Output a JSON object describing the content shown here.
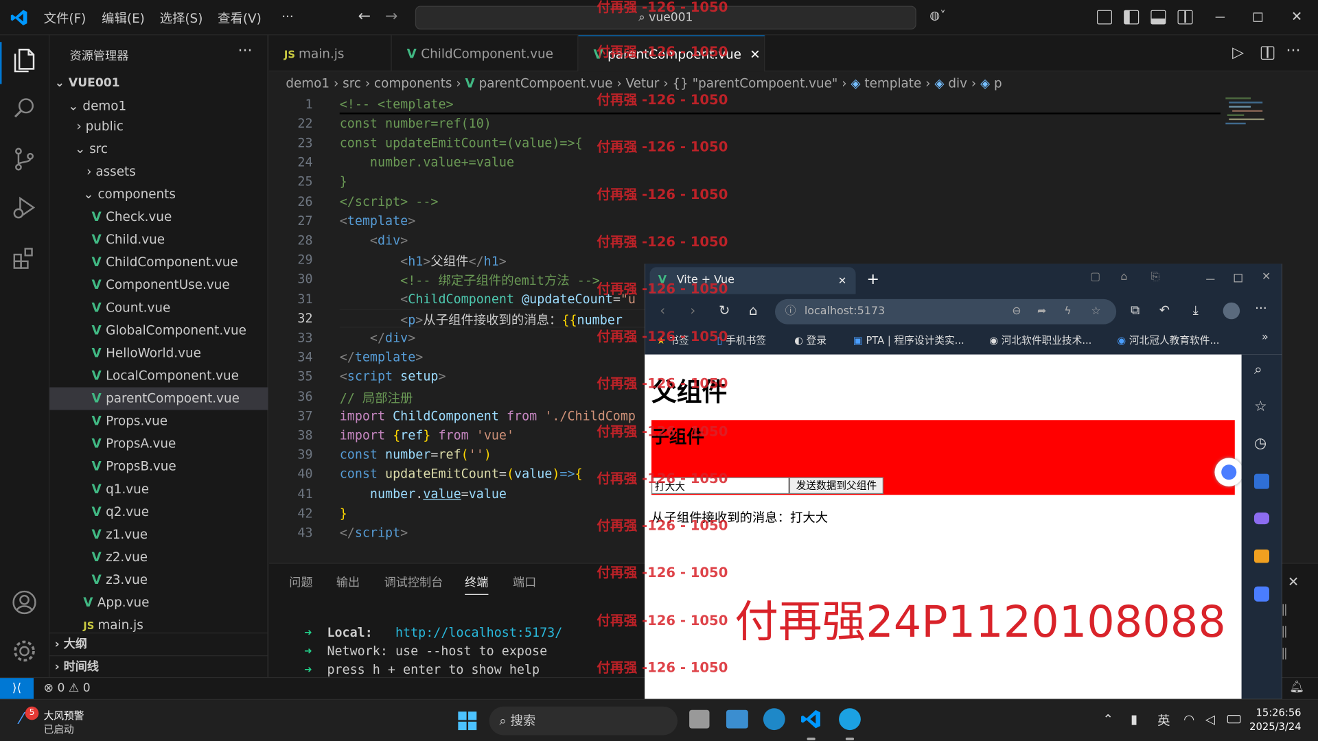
{
  "titlebar": {
    "menus": [
      "文件(F)",
      "编辑(E)",
      "选择(S)",
      "查看(V)",
      "···"
    ],
    "search": "vue001"
  },
  "sidebar": {
    "title": "资源管理器",
    "root": "VUE001",
    "items": [
      "demo1",
      "public",
      "src",
      "assets",
      "components",
      "Check.vue",
      "Child.vue",
      "ChildComponent.vue",
      "ComponentUse.vue",
      "Count.vue",
      "GlobalComponent.vue",
      "HelloWorld.vue",
      "LocalComponent.vue",
      "parentCompoent.vue",
      "Props.vue",
      "PropsA.vue",
      "PropsB.vue",
      "q1.vue",
      "q2.vue",
      "z1.vue",
      "z2.vue",
      "z3.vue",
      "App.vue",
      "main.js"
    ],
    "outline": "大纲",
    "timeline": "时间线"
  },
  "tabs": [
    "main.js",
    "ChildComponent.vue",
    "parentCompoent.vue"
  ],
  "breadcrumb": [
    "demo1",
    "src",
    "components",
    "parentCompoent.vue",
    "Vetur",
    "{} \"parentCompoent.vue\"",
    "template",
    "div",
    "p"
  ],
  "editor": {
    "line_numbers": [
      "1",
      "22",
      "23",
      "24",
      "25",
      "26",
      "27",
      "28",
      "29",
      "30",
      "31",
      "32",
      "33",
      "34",
      "35",
      "36",
      "37",
      "38",
      "39",
      "40",
      "41",
      "42",
      "43"
    ]
  },
  "panel": {
    "tabs": [
      "问题",
      "输出",
      "调试控制台",
      "终端",
      "端口"
    ],
    "term_local_label": "Local:",
    "term_local_url": "http://localhost:5173/",
    "term_network": "Network: use --host to expose",
    "term_help": "press h + enter to show help"
  },
  "status": {
    "errors": "0",
    "warnings": "0"
  },
  "browser": {
    "tab_title": "Vite + Vue",
    "url": "localhost:5173",
    "bookmarks": [
      "书签",
      "手机书签",
      "登录",
      "PTA | 程序设计类实...",
      "河北软件职业技术...",
      "河北冠人教育软件..."
    ],
    "page": {
      "h1": "父组件",
      "child_h2": "子组件",
      "input_value": "打大大",
      "button": "发送数据到父组件",
      "message": "从子组件接收到的消息：打大大"
    }
  },
  "watermark": {
    "small": "付再强 -126 - 1050",
    "big": "付再强24P1120108088"
  },
  "taskbar": {
    "weather_title": "大风预警",
    "weather_sub": "已启动",
    "weather_badge": "5",
    "search": "搜索",
    "ime": "英",
    "time": "15:26:56",
    "date": "2025/3/24"
  }
}
